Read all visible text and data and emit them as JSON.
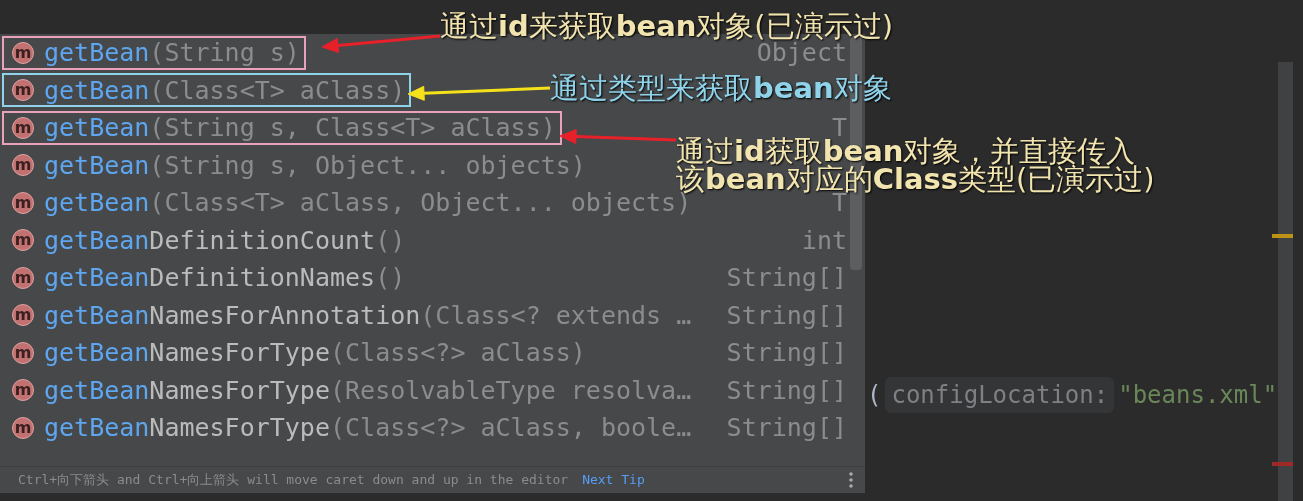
{
  "completion_popup": {
    "items": [
      {
        "icon": "m",
        "match": "getBean",
        "params": "(String s)",
        "return_type": "Object",
        "color": "#e8a3bb"
      },
      {
        "icon": "m",
        "match": "getBean",
        "params": "(Class<T> aClass)",
        "color": "#8fd3ea"
      },
      {
        "icon": "m",
        "match": "getBean",
        "params": "(String s, Class<T> aClass)",
        "return_type": "T",
        "color": "#e8a3bb"
      },
      {
        "icon": "m",
        "match": "getBean",
        "params": "(String s, Object... objects)"
      },
      {
        "icon": "m",
        "match": "getBean",
        "params": "(Class<T> aClass, Object... objects)",
        "return_type": "T"
      },
      {
        "icon": "m",
        "match": "getBean",
        "name_rest": "DefinitionCount",
        "params": "()",
        "return_type": "int"
      },
      {
        "icon": "m",
        "match": "getBean",
        "name_rest": "DefinitionNames",
        "params": "()",
        "return_type": "String[]"
      },
      {
        "icon": "m",
        "match": "getBean",
        "name_rest": "NamesForAnnotation",
        "params": "(Class<? extends …",
        "return_type": "String[]"
      },
      {
        "icon": "m",
        "match": "getBean",
        "name_rest": "NamesForType",
        "params": "(Class<?> aClass)",
        "return_type": "String[]"
      },
      {
        "icon": "m",
        "match": "getBean",
        "name_rest": "NamesForType",
        "params": "(ResolvableType resolva…",
        "return_type": "String[]"
      },
      {
        "icon": "m",
        "match": "getBean",
        "name_rest": "NamesForType",
        "params": "(Class<?> aClass, boole…",
        "return_type": "String[]"
      }
    ],
    "footer": {
      "hint": "Ctrl+向下箭头 and Ctrl+向上箭头 will move caret down and up in the editor",
      "link": "Next Tip"
    }
  },
  "editor": {
    "code_prefix": "(",
    "parameter_hint": "configLocation:",
    "string_literal": "\"beans.xml\""
  },
  "annotations": [
    {
      "lines": [
        "通过**id**来获取**bean**对象(已演示过)"
      ],
      "color": "#f2e4ae",
      "arrow": {
        "color": "#e8202a"
      }
    },
    {
      "lines": [
        "通过类型来获取**bean**对象"
      ],
      "color": "#8fd3ea",
      "arrow": {
        "color": "#f5e11a"
      }
    },
    {
      "lines": [
        "通过**id**获取**bean**对象，并直接传入",
        "该**bean**对应的**Class**类型(已演示过)"
      ],
      "color": "#f2e4ae",
      "arrow": {
        "color": "#e8202a"
      }
    }
  ]
}
